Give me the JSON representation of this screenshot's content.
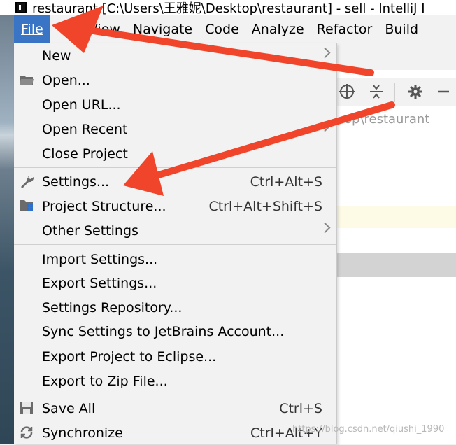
{
  "window": {
    "title": "restaurant [C:\\Users\\王雅妮\\Desktop\\restaurant] - sell - IntelliJ I"
  },
  "menubar": {
    "items": [
      "File",
      "View",
      "Navigate",
      "Code",
      "Analyze",
      "Refactor",
      "Build"
    ],
    "active": "File"
  },
  "file_menu": {
    "items": [
      {
        "label": "New",
        "shortcut": "",
        "submenu": true,
        "icon": ""
      },
      {
        "label": "Open...",
        "shortcut": "",
        "submenu": false,
        "icon": "folder-icon"
      },
      {
        "label": "Open URL...",
        "shortcut": "",
        "submenu": false,
        "icon": ""
      },
      {
        "label": "Open Recent",
        "shortcut": "",
        "submenu": true,
        "icon": ""
      },
      {
        "label": "Close Project",
        "shortcut": "",
        "submenu": false,
        "icon": ""
      },
      {
        "label": "Settings...",
        "shortcut": "Ctrl+Alt+S",
        "submenu": false,
        "icon": "wrench-icon"
      },
      {
        "label": "Project Structure...",
        "shortcut": "Ctrl+Alt+Shift+S",
        "submenu": false,
        "icon": "project-structure-icon"
      },
      {
        "label": "Other Settings",
        "shortcut": "",
        "submenu": true,
        "icon": ""
      },
      {
        "label": "Import Settings...",
        "shortcut": "",
        "submenu": false,
        "icon": ""
      },
      {
        "label": "Export Settings...",
        "shortcut": "",
        "submenu": false,
        "icon": ""
      },
      {
        "label": "Settings Repository...",
        "shortcut": "",
        "submenu": false,
        "icon": ""
      },
      {
        "label": "Sync Settings to JetBrains Account...",
        "shortcut": "",
        "submenu": false,
        "icon": ""
      },
      {
        "label": "Export Project to Eclipse...",
        "shortcut": "",
        "submenu": false,
        "icon": ""
      },
      {
        "label": "Export to Zip File...",
        "shortcut": "",
        "submenu": false,
        "icon": ""
      },
      {
        "label": "Save All",
        "shortcut": "Ctrl+S",
        "submenu": false,
        "icon": "save-icon"
      },
      {
        "label": "Synchronize",
        "shortcut": "Ctrl+Alt+Y",
        "submenu": false,
        "icon": "sync-icon"
      }
    ]
  },
  "toolbar": {
    "icons": [
      "locate-icon",
      "collapse-icon",
      "gear-icon",
      "minimize-icon"
    ]
  },
  "project_path": "op\\restaurant",
  "watermark": "https://blog.csdn.net/qiushi_1990",
  "colors": {
    "menu_active_bg": "#3a74c5",
    "annotation_arrow": "#f0452a"
  }
}
